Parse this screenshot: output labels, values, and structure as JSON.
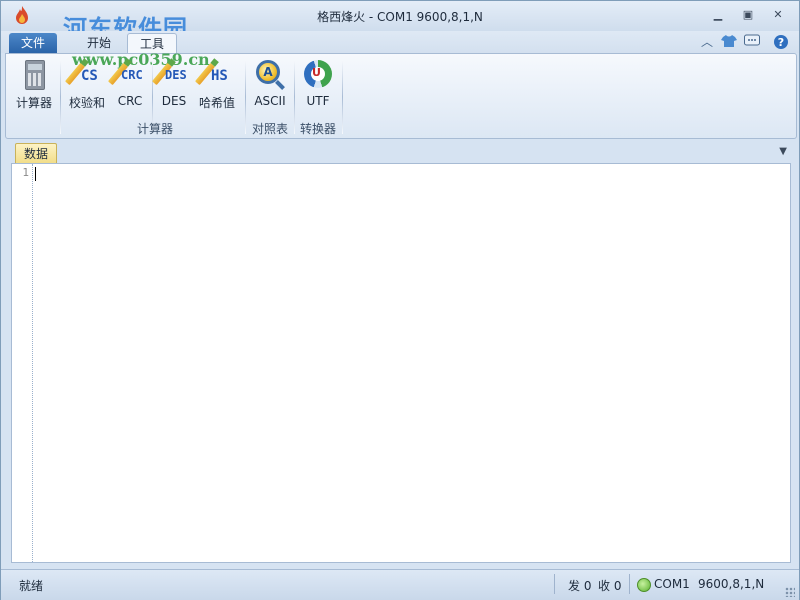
{
  "window": {
    "title": "格西烽火 - COM1  9600,8,1,N"
  },
  "watermark": {
    "line1": "河东软件园",
    "line2": "www.pc0359.cn"
  },
  "tabs": {
    "file": "文件",
    "start": "开始",
    "tools": "工具"
  },
  "ribbon": {
    "buttons": {
      "calculator": "计算器",
      "checksum": "校验和",
      "crc": "CRC",
      "des": "DES",
      "hash": "哈希值",
      "ascii": "ASCII",
      "utf": "UTF"
    },
    "icon_codes": {
      "checksum": "CS",
      "crc": "CRC",
      "des": "DES",
      "hash": "HS",
      "ascii": "A",
      "utf": "U"
    },
    "groups": {
      "calculators": "计算器",
      "table": "对照表",
      "converters": "转换器"
    }
  },
  "document": {
    "tab": "数据",
    "line_numbers": [
      "1"
    ],
    "content": ""
  },
  "status": {
    "ready": "就绪",
    "sent": "发 0",
    "received": "收 0",
    "port": "COM1",
    "settings": "9600,8,1,N"
  },
  "icons": [
    "app-icon",
    "minimize-icon",
    "maximize-icon",
    "close-icon",
    "collapse-ribbon-icon",
    "skin-shirt-icon",
    "chat-icon",
    "help-icon",
    "calculator-icon",
    "checksum-pencil-icon",
    "crc-pencil-icon",
    "des-pencil-icon",
    "hash-pencil-icon",
    "ascii-magnifier-icon",
    "utf-convert-icon",
    "dropdown-arrow-icon",
    "connection-status-led-icon",
    "resize-grip-icon"
  ],
  "colors": {
    "accent": "#2a63a8",
    "ribbon_bg": "#dce7f4",
    "doc_tab": "#f1dc86",
    "status_led": "#5bb12f"
  }
}
